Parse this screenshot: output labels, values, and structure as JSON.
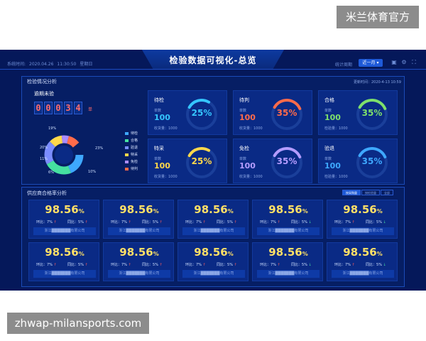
{
  "watermarks": {
    "top": "米兰体育官方",
    "bottom": "zhwap-milansports.com"
  },
  "header": {
    "system_time_label": "系统时间:",
    "date": "2020.04.26",
    "time": "11:30:50",
    "weekday": "星期日",
    "title": "检验数据可视化-总览",
    "period_label": "统计周期",
    "period_value": "近一月 ▾"
  },
  "inspection": {
    "title": "检验情况分析",
    "update_time": "更新时间：2020-4-13 10:59",
    "overdue_title": "逾期未验",
    "overdue_digits": [
      "0",
      "0",
      "0",
      "3",
      "4"
    ],
    "overdue_unit": "单",
    "donut_percents": [
      "19%",
      "23%",
      "20%",
      "11%",
      "6%",
      "10%"
    ],
    "legend": [
      {
        "label": "待检",
        "color": "#3ea8ff"
      },
      {
        "label": "合格",
        "color": "#45e0a0"
      },
      {
        "label": "验退",
        "color": "#7a8cff"
      },
      {
        "label": "特采",
        "color": "#ffd84a"
      },
      {
        "label": "免检",
        "color": "#a98cff"
      },
      {
        "label": "待判",
        "color": "#ff6b4a"
      }
    ]
  },
  "status_cards": [
    {
      "title": "待检",
      "count_label": "单数",
      "count": "100",
      "qty_label": "收货量：1000",
      "percent": "25%",
      "percent_value": 0.25,
      "color": "#35c6ff",
      "count_color": "#35c6ff"
    },
    {
      "title": "待判",
      "count_label": "单数",
      "count": "100",
      "qty_label": "收货量：1000",
      "percent": "35%",
      "percent_value": 0.35,
      "color": "#ff6b4a",
      "count_color": "#ff6b4a"
    },
    {
      "title": "合格",
      "count_label": "单数",
      "count": "100",
      "qty_label": "检验量：1000",
      "percent": "35%",
      "percent_value": 0.35,
      "color": "#7ee06b",
      "count_color": "#7ee06b"
    },
    {
      "title": "特采",
      "count_label": "单数",
      "count": "100",
      "qty_label": "收货量：1000",
      "percent": "25%",
      "percent_value": 0.25,
      "color": "#ffd84a",
      "count_color": "#ffd84a"
    },
    {
      "title": "免检",
      "count_label": "单数",
      "count": "100",
      "qty_label": "收货量：1000",
      "percent": "35%",
      "percent_value": 0.35,
      "color": "#b49cff",
      "count_color": "#b49cff"
    },
    {
      "title": "验退",
      "count_label": "单数",
      "count": "100",
      "qty_label": "检验量：1000",
      "percent": "35%",
      "percent_value": 0.35,
      "color": "#3ea8ff",
      "count_color": "#3ea8ff"
    }
  ],
  "supplier": {
    "title": "供应商合格率分析",
    "tabs": [
      "按采购量",
      "按检验量",
      "全部"
    ],
    "cards": [
      {
        "rate": "98.56",
        "unit": "%",
        "yoy_label": "环比：",
        "yoy": "7%",
        "yoy_dir": "up",
        "mom_label": "同比：",
        "mom": "5%",
        "mom_dir": "up",
        "company": "浙江███████有限公司"
      },
      {
        "rate": "98.56",
        "unit": "%",
        "yoy_label": "环比：",
        "yoy": "7%",
        "yoy_dir": "up",
        "mom_label": "同比：",
        "mom": "5%",
        "mom_dir": "up",
        "company": "浙江███████有限公司"
      },
      {
        "rate": "98.56",
        "unit": "%",
        "yoy_label": "环比：",
        "yoy": "7%",
        "yoy_dir": "up",
        "mom_label": "同比：",
        "mom": "5%",
        "mom_dir": "up",
        "company": "浙江███████有限公司"
      },
      {
        "rate": "98.56",
        "unit": "%",
        "yoy_label": "环比：",
        "yoy": "7%",
        "yoy_dir": "up",
        "mom_label": "同比：",
        "mom": "5%",
        "mom_dir": "down",
        "company": "浙江███████有限公司"
      },
      {
        "rate": "98.56",
        "unit": "%",
        "yoy_label": "环比：",
        "yoy": "7%",
        "yoy_dir": "up",
        "mom_label": "同比：",
        "mom": "5%",
        "mom_dir": "down",
        "company": "浙江███████有限公司"
      },
      {
        "rate": "98.56",
        "unit": "%",
        "yoy_label": "环比：",
        "yoy": "7%",
        "yoy_dir": "up",
        "mom_label": "同比：",
        "mom": "5%",
        "mom_dir": "up",
        "company": "浙江███████有限公司"
      },
      {
        "rate": "98.56",
        "unit": "%",
        "yoy_label": "环比：",
        "yoy": "7%",
        "yoy_dir": "up",
        "mom_label": "同比：",
        "mom": "5%",
        "mom_dir": "up",
        "company": "浙江███████有限公司"
      },
      {
        "rate": "98.56",
        "unit": "%",
        "yoy_label": "环比：",
        "yoy": "7%",
        "yoy_dir": "up",
        "mom_label": "同比：",
        "mom": "5%",
        "mom_dir": "up",
        "company": "浙江███████有限公司"
      },
      {
        "rate": "98.56",
        "unit": "%",
        "yoy_label": "环比：",
        "yoy": "7%",
        "yoy_dir": "up",
        "mom_label": "同比：",
        "mom": "5%",
        "mom_dir": "down",
        "company": "浙江███████有限公司"
      },
      {
        "rate": "98.56",
        "unit": "%",
        "yoy_label": "环比：",
        "yoy": "7%",
        "yoy_dir": "up",
        "mom_label": "同比：",
        "mom": "5%",
        "mom_dir": "down",
        "company": "浙江███████有限公司"
      }
    ]
  }
}
